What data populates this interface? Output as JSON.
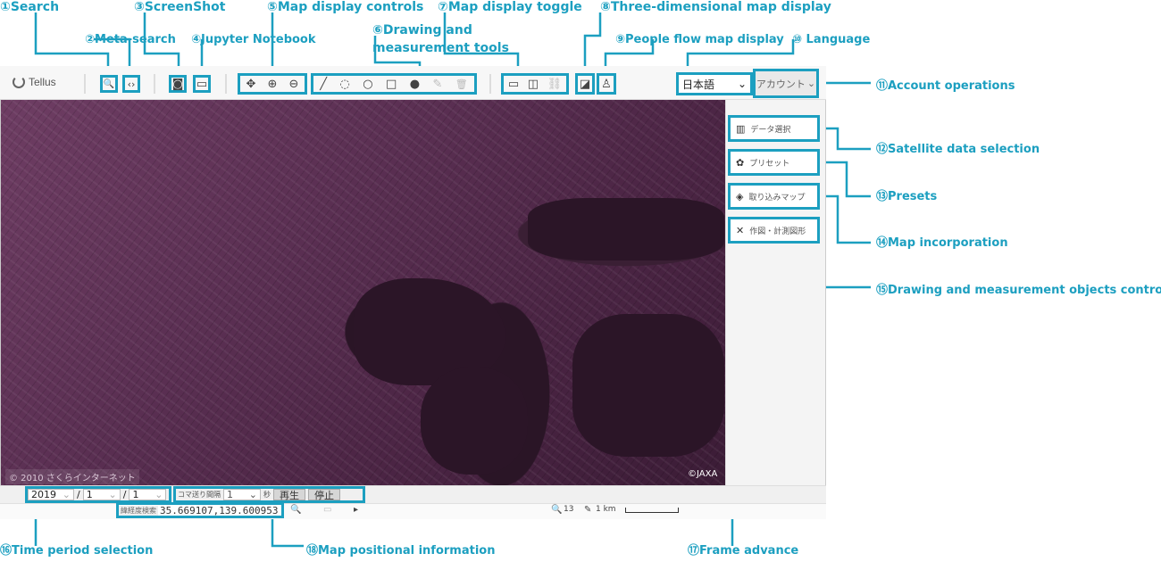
{
  "callouts": {
    "search": "①Search",
    "meta_search": "②Meta-search",
    "screenshot": "③ScreenShot",
    "jupyter": "④Jupyter Notebook",
    "map_controls": "⑤Map display controls",
    "drawing_tools_1": "⑥Drawing and",
    "drawing_tools_2": "measurement tools",
    "display_toggle": "⑦Map display toggle",
    "three_d": "⑧Three-dimensional map display",
    "people_flow": "⑨People flow map display",
    "language": "⑩ Language",
    "account_ops": "⑪Account operations",
    "satellite_selection": "⑫Satellite data selection",
    "presets": "⑬Presets",
    "map_incorporation": "⑭Map incorporation",
    "objects_control": "⑮Drawing and measurement objects control",
    "time_period": "⑯Time period selection",
    "frame_advance": "⑰Frame advance",
    "map_position": "⑱Map positional information"
  },
  "toolbar": {
    "logo_text": "Tellus",
    "language_value": "日本語",
    "account_label": "アカウント",
    "icons": {
      "search": "🔍",
      "meta_search": "‹›",
      "screenshot": "◙",
      "jupyter": "▭",
      "move": "✥",
      "zoom_in": "⊕",
      "zoom_out": "⊖",
      "line": "╱",
      "lasso": "◌",
      "circle": "○",
      "square": "□",
      "marker": "●",
      "edit": "✎",
      "trash": "🗑",
      "single_view": "▭",
      "split_view": "◫",
      "link": "⛓",
      "cube": "◪",
      "person": "♙",
      "chevron": "⌄"
    }
  },
  "sidebar": {
    "items": [
      {
        "icon": "▥",
        "label": "データ選択"
      },
      {
        "icon": "✿",
        "label": "プリセット"
      },
      {
        "icon": "◈",
        "label": "取り込みマップ"
      },
      {
        "icon": "✕",
        "label": "作図・計測図形"
      }
    ]
  },
  "map": {
    "credit_left": "© 2010 さくらインターネット",
    "credit_right": "©JAXA"
  },
  "time": {
    "year": "2019",
    "month": "1",
    "day": "1",
    "separator": "/",
    "frame_interval_label": "コマ送り間隔",
    "frame_interval_value": "1",
    "seconds_unit": "秒",
    "play_label": "再生",
    "stop_label": "停止"
  },
  "position": {
    "label": "緯経度検索",
    "coords": "35.669107,139.600953",
    "zoom_level": "13",
    "scale_label": "1 km"
  },
  "colors": {
    "accent": "#1c9fc0"
  }
}
